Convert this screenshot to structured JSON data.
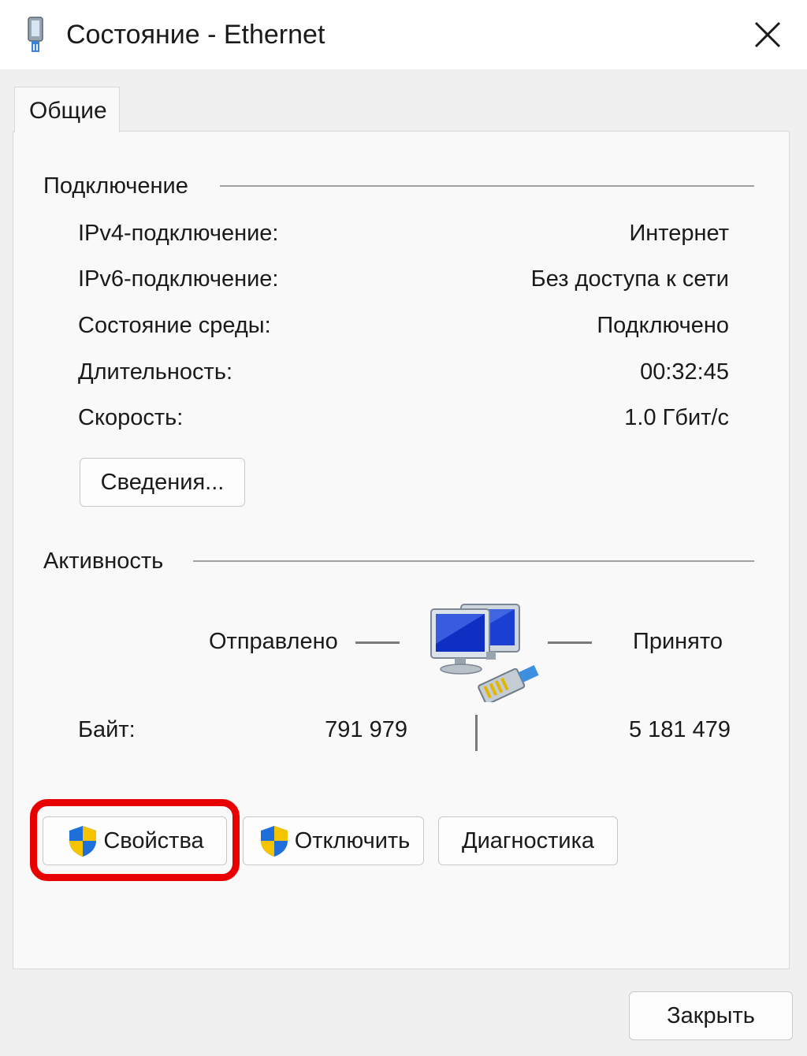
{
  "window": {
    "title": "Состояние - Ethernet"
  },
  "tabs": [
    {
      "label": "Общие"
    }
  ],
  "connection": {
    "group_title": "Подключение",
    "rows": [
      {
        "label": "IPv4-подключение:",
        "value": "Интернет"
      },
      {
        "label": "IPv6-подключение:",
        "value": "Без доступа к сети"
      },
      {
        "label": "Состояние среды:",
        "value": "Подключено"
      },
      {
        "label": "Длительность:",
        "value": "00:32:45"
      },
      {
        "label": "Скорость:",
        "value": "1.0 Гбит/с"
      }
    ],
    "details_button": "Сведения..."
  },
  "activity": {
    "group_title": "Активность",
    "sent_label": "Отправлено",
    "received_label": "Принято",
    "bytes_label": "Байт:",
    "bytes_sent": "791 979",
    "bytes_received": "5 181 479"
  },
  "buttons": {
    "properties": "Свойства",
    "disable": "Отключить",
    "diagnose": "Диагностика",
    "close": "Закрыть"
  },
  "icons": {
    "title": "ethernet-adapter-icon",
    "close": "close-icon",
    "network": "network-computers-icon",
    "uac": "uac-shield-icon"
  },
  "colors": {
    "highlight": "#e80000",
    "shield_blue": "#1e6fd9",
    "shield_yellow": "#f5c400"
  }
}
